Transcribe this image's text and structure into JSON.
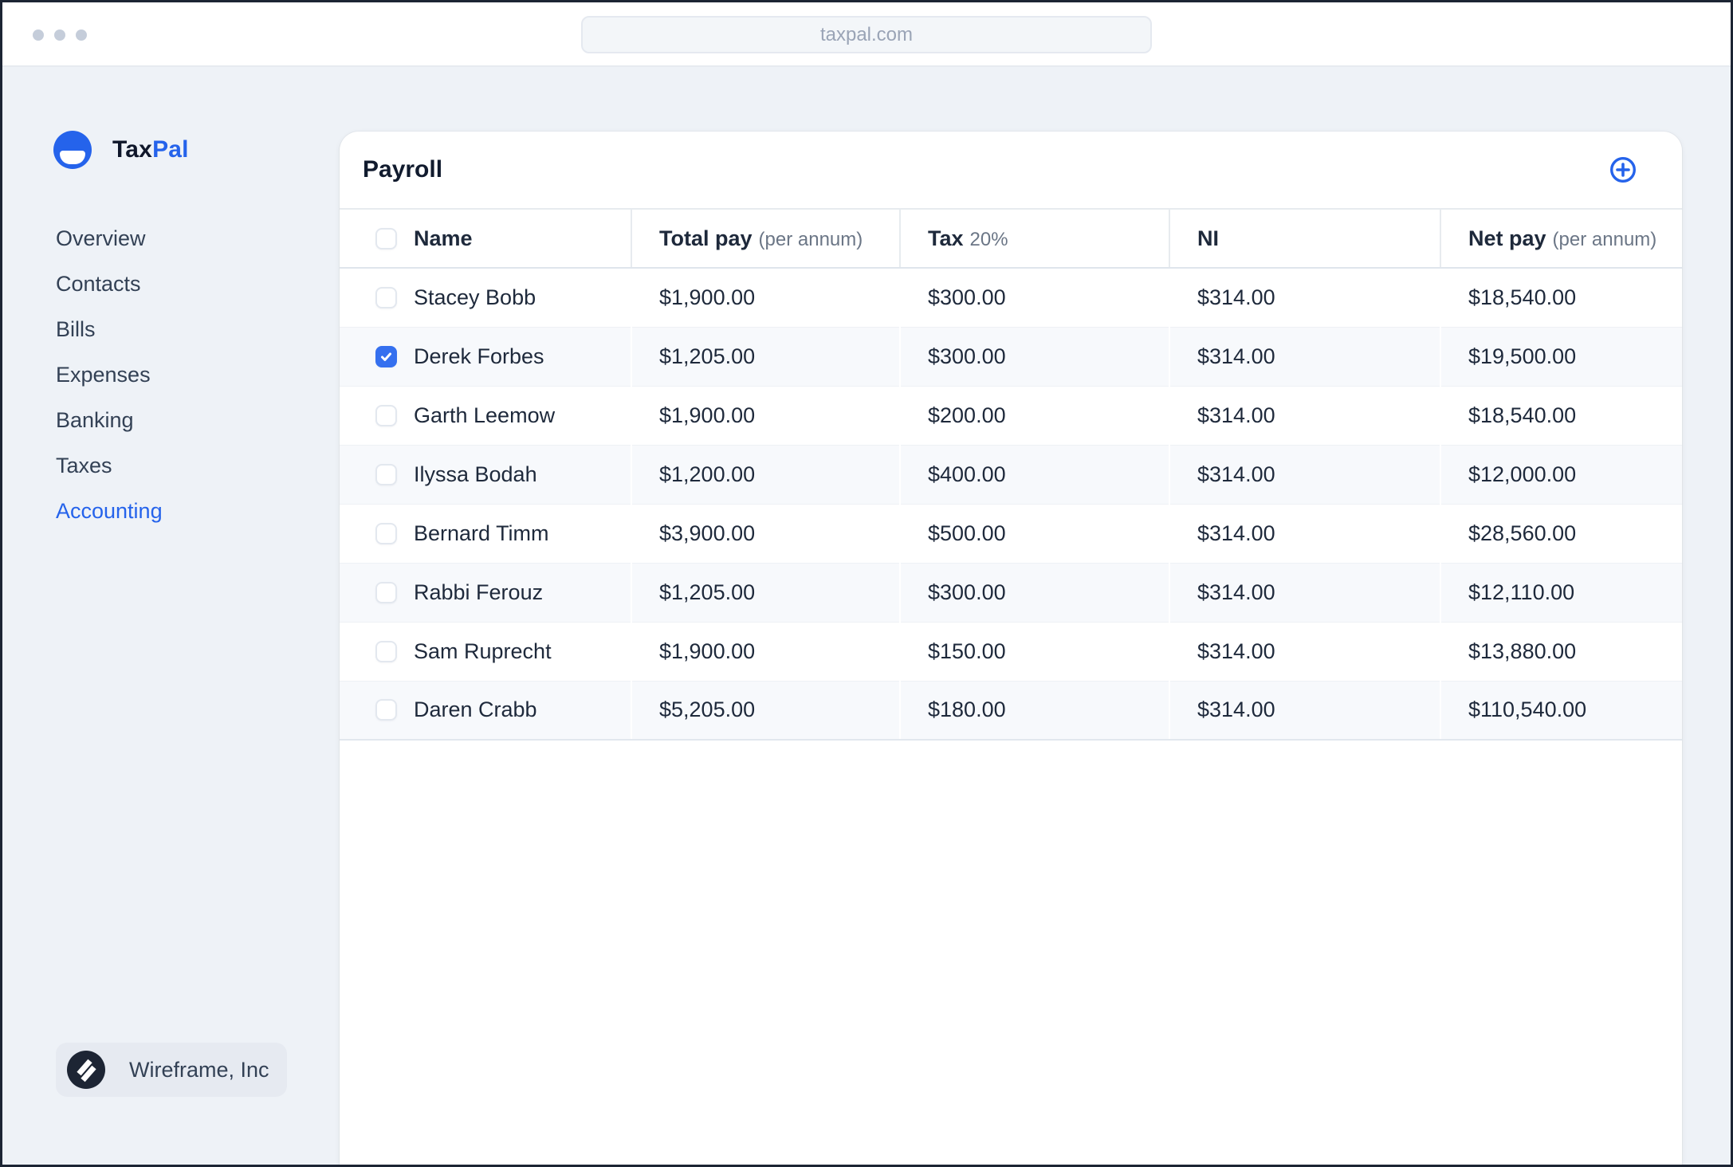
{
  "browser": {
    "url": "taxpal.com"
  },
  "brand": {
    "name_primary": "Tax",
    "name_secondary": "Pal"
  },
  "sidebar": {
    "items": [
      {
        "label": "Overview",
        "active": false
      },
      {
        "label": "Contacts",
        "active": false
      },
      {
        "label": "Bills",
        "active": false
      },
      {
        "label": "Expenses",
        "active": false
      },
      {
        "label": "Banking",
        "active": false
      },
      {
        "label": "Taxes",
        "active": false
      },
      {
        "label": "Accounting",
        "active": true
      }
    ]
  },
  "workspace": {
    "label": "Wireframe, Inc"
  },
  "payroll": {
    "title": "Payroll",
    "add_button": "circle-plus",
    "columns": {
      "name": "Name",
      "total_pay": "Total pay",
      "total_pay_sub": "(per annum)",
      "tax": "Tax",
      "tax_sub": "20%",
      "ni": "NI",
      "net_pay": "Net pay",
      "net_pay_sub": "(per annum)"
    },
    "rows": [
      {
        "name": "Stacey Bobb",
        "checked": false,
        "total": "$1,900.00",
        "tax": "$300.00",
        "ni": "$314.00",
        "net": "$18,540.00"
      },
      {
        "name": "Derek Forbes",
        "checked": true,
        "total": "$1,205.00",
        "tax": "$300.00",
        "ni": "$314.00",
        "net": "$19,500.00"
      },
      {
        "name": "Garth Leemow",
        "checked": false,
        "total": "$1,900.00",
        "tax": "$200.00",
        "ni": "$314.00",
        "net": "$18,540.00"
      },
      {
        "name": "Ilyssa Bodah",
        "checked": false,
        "total": "$1,200.00",
        "tax": "$400.00",
        "ni": "$314.00",
        "net": "$12,000.00"
      },
      {
        "name": "Bernard Timm",
        "checked": false,
        "total": "$3,900.00",
        "tax": "$500.00",
        "ni": "$314.00",
        "net": "$28,560.00"
      },
      {
        "name": "Rabbi Ferouz",
        "checked": false,
        "total": "$1,205.00",
        "tax": "$300.00",
        "ni": "$314.00",
        "net": "$12,110.00"
      },
      {
        "name": "Sam Ruprecht",
        "checked": false,
        "total": "$1,900.00",
        "tax": "$150.00",
        "ni": "$314.00",
        "net": "$13,880.00"
      },
      {
        "name": "Daren Crabb",
        "checked": false,
        "total": "$5,205.00",
        "tax": "$180.00",
        "ni": "$314.00",
        "net": "$110,540.00"
      }
    ]
  },
  "colors": {
    "accent_blue": "#2563eb",
    "checkbox_blue": "#3570ef",
    "dark_navy_text": "#1e293b",
    "page_background": "#eef2f7",
    "stripe_row": "#f7f9fc",
    "window_frame": "#1c2534"
  }
}
